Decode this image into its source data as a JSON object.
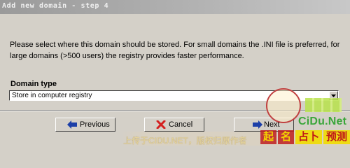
{
  "window": {
    "title": "Add new domain - step 4"
  },
  "description": "Please select where this domain should be stored. For small domains the .INI file is preferred, for large domains (>500 users) the registry provides faster performance.",
  "domain_type": {
    "label": "Domain type",
    "selected": "Store in computer registry"
  },
  "buttons": {
    "previous": "Previous",
    "cancel": "Cancel",
    "next": "Next"
  },
  "icons": {
    "previous": "arrow-left-icon",
    "cancel": "x-icon",
    "next": "arrow-right-icon",
    "dropdown": "chevron-down-icon"
  },
  "watermark": {
    "site": "CiDu.Net",
    "upload_text": "上传于CIDU.NET，版权归原作者",
    "brand_chars": [
      "起",
      "名",
      "占卜",
      "预测"
    ]
  },
  "colors": {
    "window_bg": "#d4d0c8",
    "title_bg": "#a6a6a6",
    "cancel_x": "#d42020",
    "arrow_blue": "#1c3fa8",
    "watermark_green": "#3aa63a"
  }
}
